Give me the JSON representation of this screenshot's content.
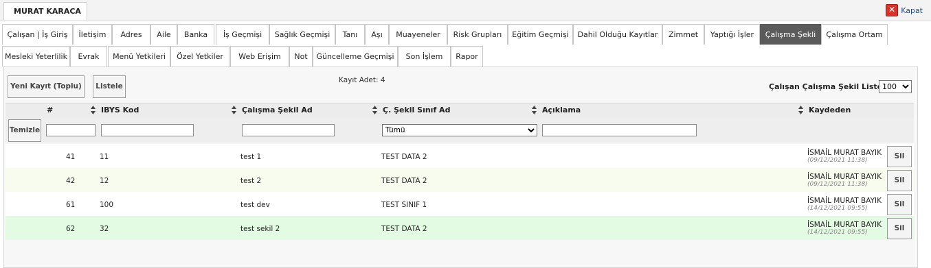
{
  "header": {
    "user_name": "MURAT KARACA",
    "close_label": "Kapat"
  },
  "tabs": {
    "row1": [
      "Çalışan | İş Giriş",
      "İletişim",
      "Adres",
      "Aile",
      "Banka",
      "İş Geçmişi",
      "Sağlık Geçmişi",
      "Tanı",
      "Aşı",
      "Muayeneler",
      "Risk Grupları",
      "Eğitim Geçmişi",
      "Dahil Olduğu Kayıtlar",
      "Zimmet",
      "Yaptığı İşler",
      "Çalışma Şekli",
      "Çalışma Ortam"
    ],
    "row2": [
      "Mesleki Yeterlilik",
      "Evrak",
      "Menü Yetkileri",
      "Özel Yetkiler",
      "Web Erişim",
      "Not",
      "Güncelleme Geçmişi",
      "Son İşlem",
      "Rapor"
    ],
    "active": "Çalışma Şekli"
  },
  "toolbar": {
    "new_record_label": "Yeni Kayıt (Toplu)",
    "list_label": "Listele",
    "record_count": "Kayıt Adet: 4"
  },
  "list_settings": {
    "label": "Çalışan Çalışma Şekil Liste",
    "page_size": "100"
  },
  "table": {
    "columns": {
      "num": "#",
      "ibys": "IBYS Kod",
      "calisma": "Çalışma Şekil Ad",
      "sinif": "Ç. Şekil Sınıf Ad",
      "aciklama": "Açıklama",
      "kaydeden": "Kaydeden"
    },
    "filters": {
      "clear_label": "Temizle",
      "sinif_selected": "Tümü"
    },
    "delete_label": "Sil",
    "rows": [
      {
        "num": "41",
        "ibys": "11",
        "calisma": "test 1",
        "sinif": "TEST DATA 2",
        "aciklama": "",
        "user": "İSMAİL MURAT BAYIK",
        "date": "(09/12/2021 11:38)"
      },
      {
        "num": "42",
        "ibys": "12",
        "calisma": "test 2",
        "sinif": "TEST DATA 2",
        "aciklama": "",
        "user": "İSMAİL MURAT BAYIK",
        "date": "(09/12/2021 11:38)"
      },
      {
        "num": "61",
        "ibys": "100",
        "calisma": "test dev",
        "sinif": "TEST SINIF 1",
        "aciklama": "",
        "user": "İSMAİL MURAT BAYIK",
        "date": "(14/12/2021 09:55)"
      },
      {
        "num": "62",
        "ibys": "32",
        "calisma": "test sekil 2",
        "sinif": "TEST DATA 2",
        "aciklama": "",
        "user": "İSMAİL MURAT BAYIK",
        "date": "(14/12/2021 09:55)"
      }
    ]
  },
  "colors": {
    "active_tab": "#5b5b5b",
    "row_alt": "#f8fcef",
    "row_highlight": "#e3fbe3",
    "close_red": "#d9342b"
  }
}
